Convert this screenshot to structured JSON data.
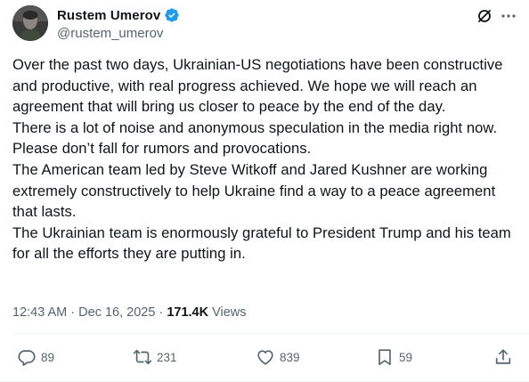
{
  "author": {
    "display_name": "Rustem Umerov",
    "handle": "@rustem_umerov"
  },
  "icons": {
    "verified": "verified-badge-icon",
    "grok": "grok-icon",
    "more": "more-options-icon",
    "reply": "reply-icon",
    "retweet": "retweet-icon",
    "like": "like-icon",
    "bookmark": "bookmark-icon",
    "share": "share-icon"
  },
  "colors": {
    "verified": "#1d9bf0",
    "text": "#0f1419",
    "secondary": "#536471"
  },
  "tweet": {
    "paragraphs": [
      "Over the past two days, Ukrainian-US negotiations have been constructive and productive, with real progress achieved. We hope we will reach an agreement that will bring us closer to peace by the end of the day.",
      "There is a lot of noise and anonymous speculation in the media right now. Please don’t fall for rumors and provocations.",
      "The American team led by Steve Witkoff and Jared Kushner are working extremely constructively to help Ukraine find a way to a peace agreement that lasts.",
      "The Ukrainian team is enormously grateful to President Trump and his team for all the efforts they are putting in."
    ]
  },
  "meta": {
    "time": "12:43 AM",
    "separator1": " · ",
    "date": "Dec 16, 2025",
    "separator2": " · ",
    "views_count": "171.4K",
    "views_label": " Views"
  },
  "actions": {
    "replies": "89",
    "retweets": "231",
    "likes": "839",
    "bookmarks": "59"
  }
}
